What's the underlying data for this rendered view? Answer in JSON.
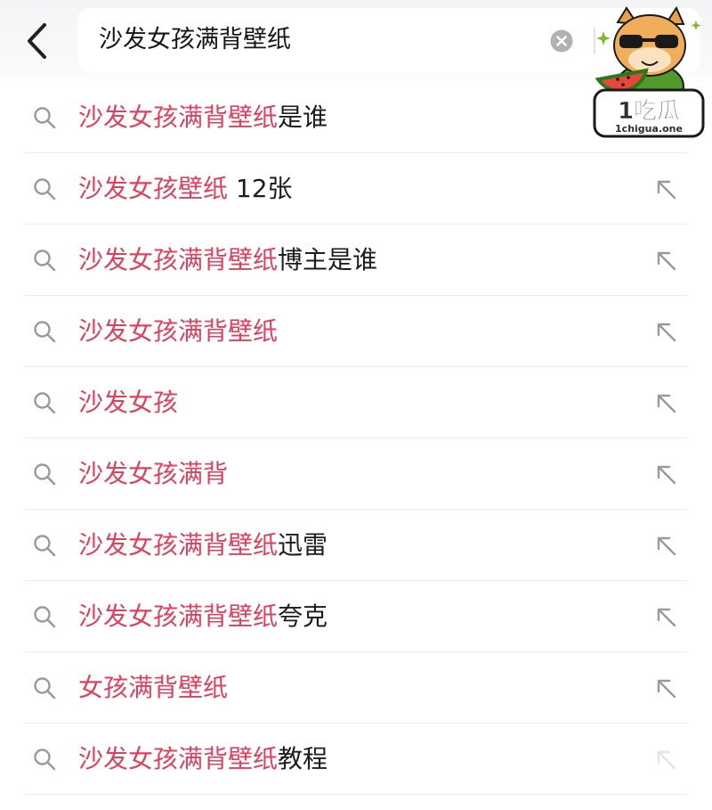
{
  "header": {
    "back_icon": "chevron-left-icon",
    "search": {
      "value": "沙发女孩满背壁纸",
      "clear_icon": "close-circle-icon"
    },
    "watermark": {
      "mascot": "hamster-with-sunglasses-and-watermelon",
      "brand_text": "1吃瓜",
      "site_text": "1chigua.one"
    }
  },
  "suggestions": [
    {
      "highlight": "沙发女孩满背壁纸",
      "rest": "是谁"
    },
    {
      "highlight": "沙发女孩壁纸",
      "rest": " 12张"
    },
    {
      "highlight": "沙发女孩满背壁纸",
      "rest": "博主是谁"
    },
    {
      "highlight": "沙发女孩满背壁纸",
      "rest": ""
    },
    {
      "highlight": "沙发女孩",
      "rest": ""
    },
    {
      "highlight": "沙发女孩满背",
      "rest": ""
    },
    {
      "highlight": "沙发女孩满背壁纸",
      "rest": "迅雷"
    },
    {
      "highlight": "沙发女孩满背壁纸",
      "rest": "夸克"
    },
    {
      "highlight": "女孩满背壁纸",
      "rest": ""
    },
    {
      "highlight": "沙发女孩满背壁纸",
      "rest": "教程"
    }
  ],
  "icons": {
    "row_leading": "search-icon",
    "row_trailing": "arrow-up-left-icon"
  },
  "colors": {
    "highlight": "#e0405c",
    "text": "#1c1c1c",
    "icon": "#9a9a9a",
    "header_bg": "#f4f4f6"
  }
}
